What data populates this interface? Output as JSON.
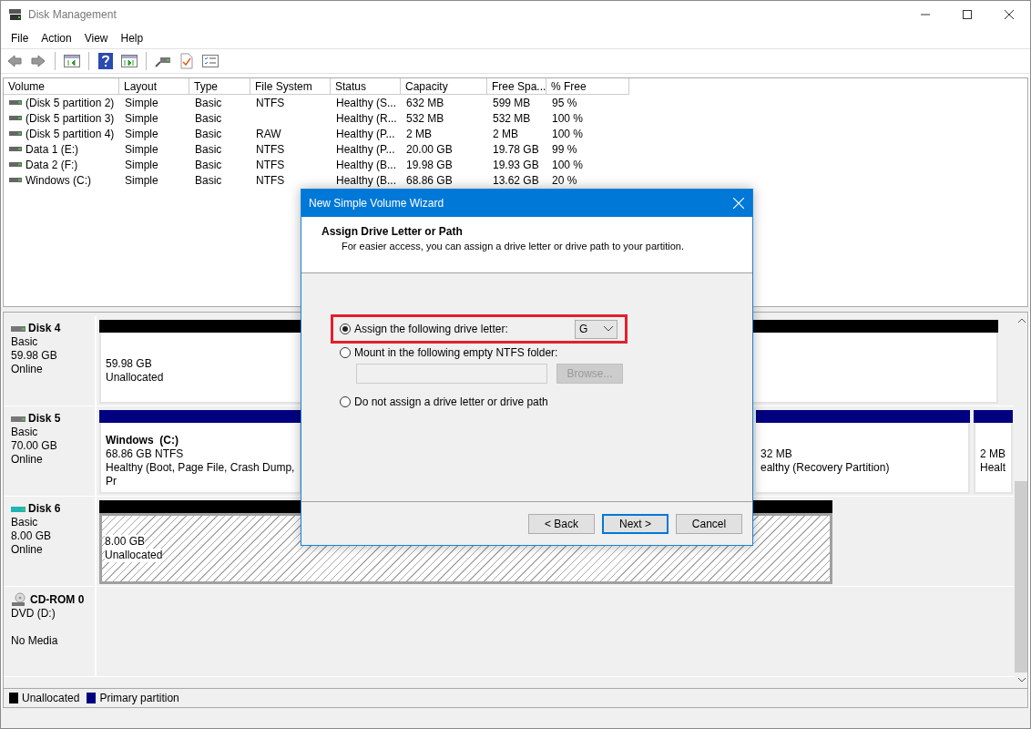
{
  "window": {
    "title": "Disk Management"
  },
  "menu": [
    "File",
    "Action",
    "View",
    "Help"
  ],
  "volume_list": {
    "columns": [
      "Volume",
      "Layout",
      "Type",
      "File System",
      "Status",
      "Capacity",
      "Free Spa...",
      "% Free"
    ],
    "rows": [
      {
        "cells": [
          "(Disk 5 partition 2)",
          "Simple",
          "Basic",
          "NTFS",
          "Healthy (S...",
          "632 MB",
          "599 MB",
          "95 %"
        ]
      },
      {
        "cells": [
          "(Disk 5 partition 3)",
          "Simple",
          "Basic",
          "",
          "Healthy (R...",
          "532 MB",
          "532 MB",
          "100 %"
        ]
      },
      {
        "cells": [
          "(Disk 5 partition 4)",
          "Simple",
          "Basic",
          "RAW",
          "Healthy (P...",
          "2 MB",
          "2 MB",
          "100 %"
        ]
      },
      {
        "cells": [
          "Data 1 (E:)",
          "Simple",
          "Basic",
          "NTFS",
          "Healthy (P...",
          "20.00 GB",
          "19.78 GB",
          "99 %"
        ]
      },
      {
        "cells": [
          "Data 2 (F:)",
          "Simple",
          "Basic",
          "NTFS",
          "Healthy (B...",
          "19.98 GB",
          "19.93 GB",
          "100 %"
        ]
      },
      {
        "cells": [
          "Windows (C:)",
          "Simple",
          "Basic",
          "NTFS",
          "Healthy (B...",
          "68.86 GB",
          "13.62 GB",
          "20 %"
        ]
      }
    ]
  },
  "disks": [
    {
      "kind": "disk",
      "name": "Disk 4",
      "selected": false,
      "lines": [
        "Basic",
        "59.98 GB",
        "Online"
      ],
      "partitions": [
        {
          "kind": "unallocated",
          "selected": false,
          "lines": [
            "59.98 GB",
            "Unallocated"
          ]
        }
      ]
    },
    {
      "kind": "disk",
      "name": "Disk 5",
      "selected": false,
      "lines": [
        "Basic",
        "70.00 GB",
        "Online"
      ],
      "partitions": [
        {
          "kind": "primary",
          "selected": false,
          "title": "Windows  (C:)",
          "lines": [
            "68.86 GB NTFS",
            "Healthy (Boot, Page File, Crash Dump, Pr"
          ]
        },
        {
          "kind": "primary",
          "selected": false,
          "lines": [
            "32 MB",
            "ealthy (Recovery Partition)"
          ]
        },
        {
          "kind": "primary",
          "selected": false,
          "lines": [
            "2 MB",
            "Healt"
          ]
        }
      ]
    },
    {
      "kind": "disk",
      "name": "Disk 6",
      "selected": true,
      "lines": [
        "Basic",
        "8.00 GB",
        "Online"
      ],
      "partitions": [
        {
          "kind": "unallocated",
          "selected": true,
          "lines": [
            "8.00 GB",
            "Unallocated"
          ]
        }
      ]
    },
    {
      "kind": "cdrom",
      "name": "CD-ROM 0",
      "selected": false,
      "lines": [
        "DVD (D:)",
        "No Media"
      ]
    }
  ],
  "legend": [
    {
      "label": "Unallocated",
      "color": "#000000"
    },
    {
      "label": "Primary partition",
      "color": "#000080"
    }
  ],
  "dialog": {
    "title": "New Simple Volume Wizard",
    "heading": "Assign Drive Letter or Path",
    "subheading": "For easier access, you can assign a drive letter or drive path to your partition.",
    "options": [
      {
        "label": "Assign the following drive letter:",
        "selected": true,
        "highlighted": true
      },
      {
        "label": "Mount in the following empty NTFS folder:",
        "selected": false,
        "highlighted": false
      },
      {
        "label": "Do not assign a drive letter or drive path",
        "selected": false,
        "highlighted": false
      }
    ],
    "drive_letter": "G",
    "folder_field": {
      "disabled": true
    },
    "browse_button": {
      "label": "Browse...",
      "disabled": true
    },
    "buttons": [
      {
        "label": "< Back",
        "default": false
      },
      {
        "label": "Next >",
        "default": true
      },
      {
        "label": "Cancel",
        "default": false
      }
    ]
  }
}
